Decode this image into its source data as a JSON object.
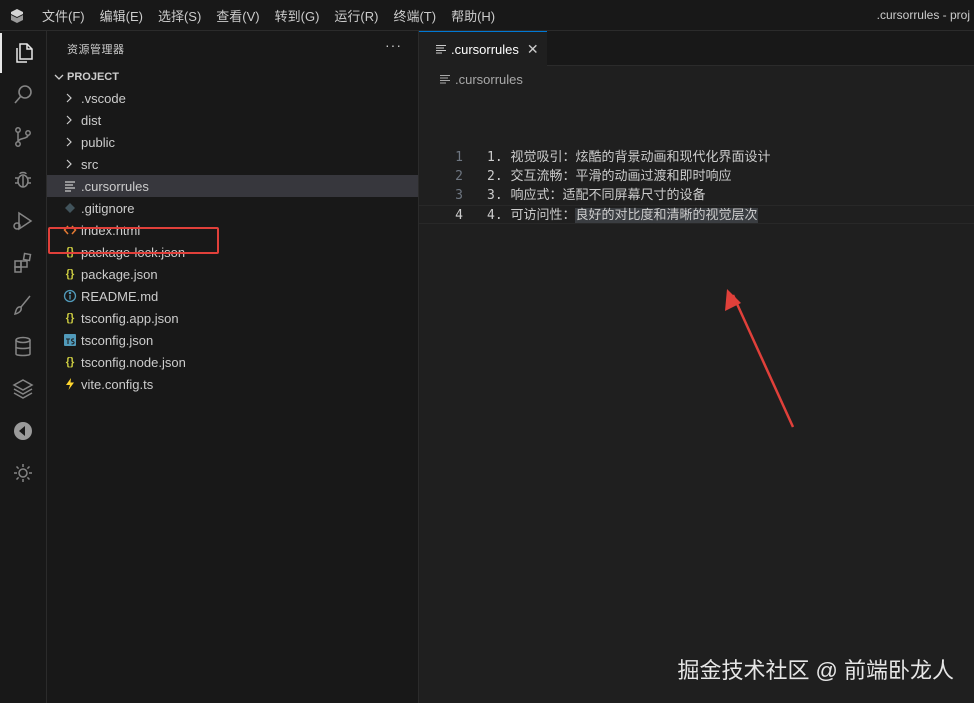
{
  "menu": {
    "items": [
      "文件(F)",
      "编辑(E)",
      "选择(S)",
      "查看(V)",
      "转到(G)",
      "运行(R)",
      "终端(T)",
      "帮助(H)"
    ],
    "window_title": ".cursorrules - proj"
  },
  "sidebar": {
    "title": "资源管理器",
    "more": "···",
    "section": "PROJECT",
    "items": [
      {
        "label": ".vscode",
        "kind": "folder",
        "icon": "chevron-right-icon"
      },
      {
        "label": "dist",
        "kind": "folder",
        "icon": "chevron-right-icon"
      },
      {
        "label": "public",
        "kind": "folder",
        "icon": "chevron-right-icon"
      },
      {
        "label": "src",
        "kind": "folder",
        "icon": "chevron-right-icon"
      },
      {
        "label": ".cursorrules",
        "kind": "file",
        "icon": "lines-file-icon",
        "selected": true
      },
      {
        "label": ".gitignore",
        "kind": "file",
        "icon": "git-diamond-icon"
      },
      {
        "label": "index.html",
        "kind": "file",
        "icon": "html-brackets-icon"
      },
      {
        "label": "package-lock.json",
        "kind": "file",
        "icon": "json-braces-icon"
      },
      {
        "label": "package.json",
        "kind": "file",
        "icon": "json-braces-icon"
      },
      {
        "label": "README.md",
        "kind": "file",
        "icon": "info-circle-icon"
      },
      {
        "label": "tsconfig.app.json",
        "kind": "file",
        "icon": "json-braces-icon"
      },
      {
        "label": "tsconfig.json",
        "kind": "file",
        "icon": "typescript-icon"
      },
      {
        "label": "tsconfig.node.json",
        "kind": "file",
        "icon": "json-braces-icon"
      },
      {
        "label": "vite.config.ts",
        "kind": "file",
        "icon": "vite-bolt-icon"
      }
    ]
  },
  "editor": {
    "tab_label": ".cursorrules",
    "tab_close": "✕",
    "breadcrumb": ".cursorrules",
    "lines": [
      {
        "number": "1",
        "text": "1. 视觉吸引：炫酷的背景动画和现代化界面设计"
      },
      {
        "number": "2",
        "text": "2. 交互流畅：平滑的动画过渡和即时响应"
      },
      {
        "number": "3",
        "text": "3. 响应式：适配不同屏幕尺寸的设备"
      },
      {
        "number": "4",
        "text_prefix": "4. 可访问性：",
        "text_selected": "良好的对比度和清晰的视觉层次",
        "current": true
      }
    ]
  },
  "watermark": "掘金技术社区 @ 前端卧龙人",
  "colors": {
    "accent": "#0078d4",
    "highlight_box": "#e0403a",
    "arrow": "#e0403a",
    "json_icon": "#cbcb41",
    "html_icon": "#e37933",
    "ts_icon": "#519aba",
    "info_icon": "#519aba",
    "vite_icon": "#ffd62e"
  }
}
